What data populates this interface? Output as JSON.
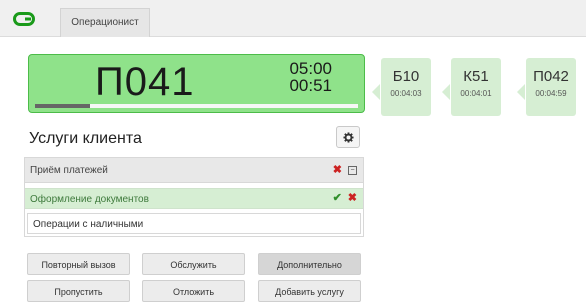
{
  "header": {
    "tab_label": "Операционист",
    "logo_icon": "link-logo-icon",
    "brand_color": "#1a9a1a"
  },
  "current_ticket": {
    "number": "П041",
    "time_total": "05:00",
    "time_elapsed": "00:51",
    "progress_fraction": 0.17
  },
  "queue": [
    {
      "number": "Б10",
      "time": "00:04:03"
    },
    {
      "number": "К51",
      "time": "00:04:01"
    },
    {
      "number": "П042",
      "time": "00:04:59"
    }
  ],
  "services": {
    "title": "Услуги клиента",
    "settings_icon": "gear-icon",
    "group_label": "Приём платежей",
    "active_item": "Оформление документов",
    "item": "Операции с наличными"
  },
  "buttons": {
    "recall": "Повторный вызов",
    "serve": "Обслужить",
    "more": "Дополнительно",
    "skip": "Пропустить",
    "postpone": "Отложить",
    "add_service": "Добавить услугу"
  }
}
